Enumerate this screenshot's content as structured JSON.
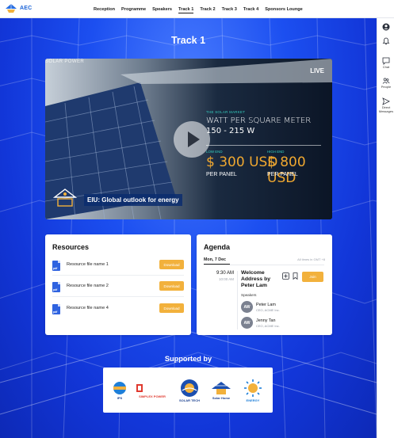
{
  "brand": {
    "name": "AEC"
  },
  "nav": {
    "items": [
      {
        "label": "Reception",
        "active": false
      },
      {
        "label": "Programme",
        "active": false
      },
      {
        "label": "Speakers",
        "active": false
      },
      {
        "label": "Track 1",
        "active": true
      },
      {
        "label": "Track 2",
        "active": false
      },
      {
        "label": "Track 3",
        "active": false
      },
      {
        "label": "Track 4",
        "active": false
      },
      {
        "label": "Sponsors Lounge",
        "active": false
      }
    ]
  },
  "rail": {
    "profile_icon": "user-circle-icon",
    "notifications_icon": "bell-icon",
    "chat_label": "Chat",
    "people_label": "People",
    "direct_messages_label": "Direct Messages"
  },
  "page": {
    "title": "Track 1"
  },
  "video": {
    "live_label": "LIVE",
    "caption": "EIU: Global outlook for energy",
    "overlay": {
      "brand": "SOLAR POWER",
      "kicker": "THE SOLAR MARKET",
      "headline": "WATT PER SQUARE METER",
      "range": "150 - 215 W",
      "low_label": "LOW END",
      "low_price": "$ 300 USD",
      "high_label": "HIGH END",
      "high_price": "$ 800 USD",
      "per_label": "PER PANEL"
    }
  },
  "resources": {
    "title": "Resources",
    "download_label": "Download",
    "items": [
      {
        "name": "Resource file name 1"
      },
      {
        "name": "Resource file name 2"
      },
      {
        "name": "Resource file name 4"
      }
    ]
  },
  "agenda": {
    "title": "Agenda",
    "date_tab": "Mon, 7 Dec",
    "timezone": "All times in GMT +8",
    "session": {
      "start": "9:30 AM",
      "end": "10:00 AM",
      "title": "Welcome Address by Peter Lam",
      "join_label": "Join",
      "speakers_label": "Speakers",
      "speakers": [
        {
          "initials": "AW",
          "name": "Peter Lam",
          "role": "CEO, ACME Inc."
        },
        {
          "initials": "AW",
          "name": "Jenny Tan",
          "role": "CEO, ACME Inc."
        }
      ]
    }
  },
  "supported": {
    "title": "Supported by",
    "sponsors": [
      {
        "name": "IPS",
        "icon": "ips-logo"
      },
      {
        "name": "SIMPLEX POWER",
        "icon": "simplex-power-logo"
      },
      {
        "name": "SOLAR TECH",
        "icon": "solar-tech-logo"
      },
      {
        "name": "Solar Home",
        "icon": "solar-home-logo"
      },
      {
        "name": "ENERGY",
        "icon": "energy-sun-logo"
      }
    ]
  },
  "colors": {
    "accent": "#f2b13c",
    "brand_blue": "#1b64d8",
    "stage_blue": "#1c4ff0"
  }
}
